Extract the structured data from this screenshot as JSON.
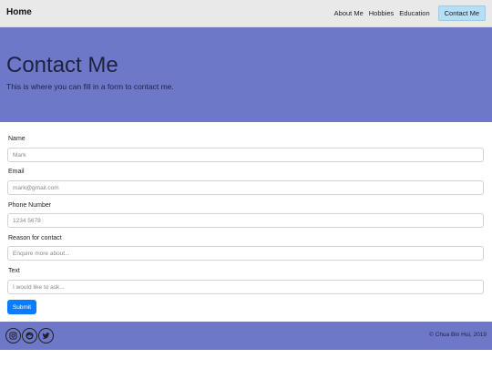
{
  "nav": {
    "brand": "Home",
    "links": [
      "About Me",
      "Hobbies",
      "Education"
    ],
    "active_link": "Contact Me"
  },
  "hero": {
    "title": "Contact Me",
    "subtitle": "This is where you can fill in a form to contact me."
  },
  "form": {
    "fields": [
      {
        "label": "Name",
        "placeholder": "Mark"
      },
      {
        "label": "Email",
        "placeholder": "mark@gmail.com"
      },
      {
        "label": "Phone Number",
        "placeholder": "1234 5678"
      },
      {
        "label": "Reason for contact",
        "placeholder": "Enquire more about..."
      },
      {
        "label": "Text",
        "placeholder": "I would like to ask..."
      }
    ],
    "submit_label": "Submit"
  },
  "footer": {
    "social_icons": [
      "instagram-icon",
      "reddit-icon",
      "twitter-icon"
    ],
    "copyright": "© Chua Bin Hui, 2019"
  },
  "colors": {
    "hero_bg": "#6e78c8",
    "navbar_bg": "#e9e9e9",
    "active_nav_bg": "#b4dff7",
    "submit_bg": "#0a7cff"
  }
}
